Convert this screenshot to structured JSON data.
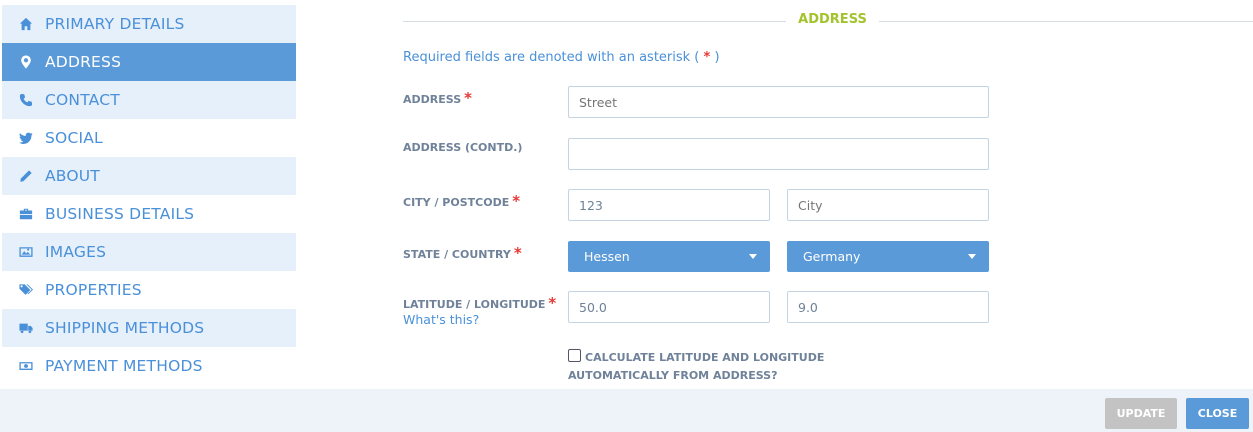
{
  "sidebar": {
    "items": [
      {
        "label": "PRIMARY DETAILS",
        "icon": "home-icon"
      },
      {
        "label": "ADDRESS",
        "icon": "map-marker-icon"
      },
      {
        "label": "CONTACT",
        "icon": "phone-icon"
      },
      {
        "label": "SOCIAL",
        "icon": "twitter-icon"
      },
      {
        "label": "ABOUT",
        "icon": "pencil-icon"
      },
      {
        "label": "BUSINESS DETAILS",
        "icon": "briefcase-icon"
      },
      {
        "label": "IMAGES",
        "icon": "image-icon"
      },
      {
        "label": "PROPERTIES",
        "icon": "tags-icon"
      },
      {
        "label": "SHIPPING METHODS",
        "icon": "truck-icon"
      },
      {
        "label": "PAYMENT METHODS",
        "icon": "money-icon"
      }
    ],
    "active": "ADDRESS"
  },
  "form": {
    "section_title": "ADDRESS",
    "required_note": {
      "prefix": "Required fields are denoted with an asterisk ( ",
      "star": "*",
      "suffix": " )"
    },
    "address": {
      "label": "ADDRESS",
      "value": "",
      "placeholder": "Street"
    },
    "address_contd": {
      "label": "ADDRESS (CONTD.)",
      "value": "",
      "placeholder": ""
    },
    "city_postcode": {
      "label": "CITY / POSTCODE",
      "postcode_value": "123",
      "city_placeholder": "City"
    },
    "state_country": {
      "label": "STATE / COUNTRY",
      "state": "Hessen",
      "country": "Germany"
    },
    "lat_long": {
      "label": "LATITUDE / LONGITUDE",
      "help": "What's this?",
      "latitude": "50.0",
      "longitude": "9.0"
    },
    "auto_calc": {
      "line1": "CALCULATE LATITUDE AND LONGITUDE",
      "line2": "AUTOMATICALLY FROM ADDRESS?",
      "checked": false
    },
    "required_star": "*"
  },
  "footer": {
    "update_label": "UPDATE",
    "close_label": "CLOSE"
  },
  "colors": {
    "accent": "#5b9ad9",
    "heading": "#a3c32d",
    "required": "#e53935",
    "disabled": "#c3c3c3"
  }
}
